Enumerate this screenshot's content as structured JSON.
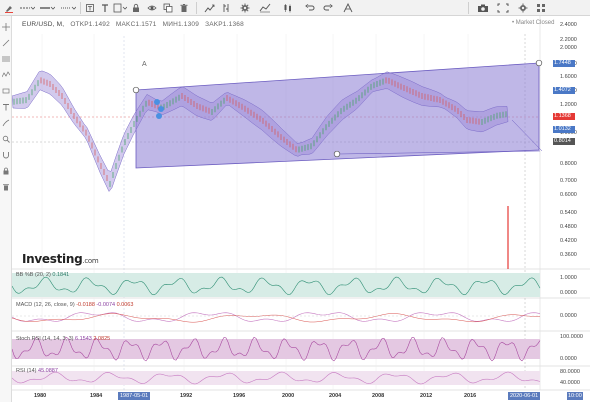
{
  "chart_header": {
    "symbol": "EUR/USD, M,",
    "open": "OTKP1.1492",
    "high": "MAKC1.1571",
    "low": "MИH1.1309",
    "close": "ЗАKP1.1368",
    "market_status": "Market Closed",
    "drawing_label": "A"
  },
  "brand": {
    "name": "Investing",
    "suffix": ".com"
  },
  "panes": {
    "bb": {
      "label": "BB %B (20, 2)",
      "value": "0.1841"
    },
    "macd": {
      "label": "MACD (12, 26, close, 9)",
      "v1": "-0.0188",
      "v2": "-0.0074",
      "v3": "0.0063"
    },
    "stoch": {
      "label": "Stoch RSI (14, 14, 3, 3)",
      "v1": "6.1543",
      "v2": "2.0825"
    },
    "rsi": {
      "label": "RSI (14)",
      "value": "45.0887"
    }
  },
  "price_axis": {
    "labels": [
      "2.4000",
      "2.2000",
      "2.0000",
      "1.8000",
      "1.6000",
      "1.4000",
      "1.2000",
      "1.0000",
      "0.8000",
      "0.7000",
      "0.6000",
      "0.5400",
      "0.4800",
      "0.4200",
      "0.3600"
    ],
    "tags": [
      {
        "text": "1.7448",
        "color": "#4a78c6"
      },
      {
        "text": "1.4072",
        "color": "#4a78c6"
      },
      {
        "text": "1.1368",
        "color": "#e53935"
      },
      {
        "text": "1.0132",
        "color": "#4a78c6"
      },
      {
        "text": "0.8014",
        "color": "#555555"
      }
    ],
    "bb_labels": [
      "1.0000",
      "0.0000"
    ],
    "macd_labels": [
      "0.0000"
    ],
    "stoch_labels": [
      "100.0000",
      "0.0000"
    ],
    "rsi_labels": [
      "80.0000",
      "40.0000"
    ]
  },
  "time_axis": {
    "labels": [
      "1980",
      "1984",
      "1992",
      "1996",
      "2000",
      "2004",
      "2008",
      "2012",
      "2016"
    ],
    "crosshair_start": "1987-05-01",
    "crosshair_end": "2020-06-01",
    "crosshair_end_tail": "10:00"
  },
  "toolbar": {
    "icons": [
      "brush-icon",
      "line-style-icon",
      "line-width-icon",
      "color-picker-icon",
      "text-icon",
      "type-icon",
      "template-icon",
      "lock-icon",
      "visibility-icon",
      "clone-icon",
      "delete-icon"
    ],
    "right_icons": [
      "camera-icon",
      "zoom-icon",
      "bar-style-icon",
      "undo-icon",
      "redo-icon",
      "indicator-icon",
      "settings-icon",
      "chart-type-icon",
      "layout-icon",
      "fullscreen-icon"
    ]
  },
  "colors": {
    "channel": "#7b6bc9",
    "band_fill": "#9c8ad8",
    "up_candle": "#3aa35a",
    "down_candle": "#d9534f",
    "indicator_pink": "#c77bc2",
    "bb_teal": "#2f8f74"
  }
}
